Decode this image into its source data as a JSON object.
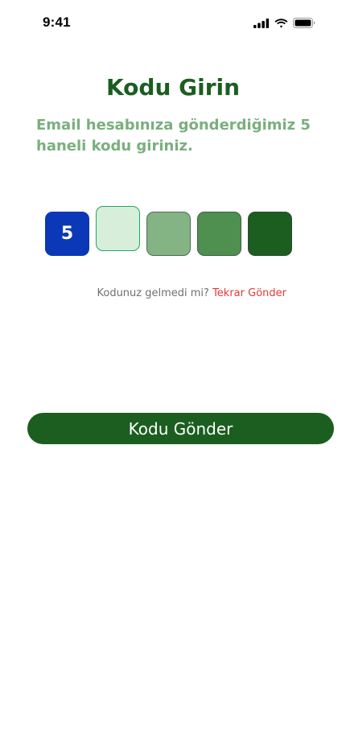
{
  "status_bar": {
    "time": "9:41",
    "icons": [
      "signal-icon",
      "wifi-icon",
      "battery-icon"
    ]
  },
  "title": "Kodu Girin",
  "subtitle": "Email hesabınıza gönderdiğimiz 5 haneli kodu giriniz.",
  "code_inputs": [
    "5",
    "",
    "",
    "",
    ""
  ],
  "resend": {
    "prompt": "Kodunuz gelmedi mi?",
    "link": "Tekrar Gönder"
  },
  "submit_label": "Kodu Gönder",
  "colors": {
    "primary": "#1b5e20",
    "subtitle": "#7aaf7d",
    "filled_box": "#0b38b6",
    "active_box": "#d7eedb",
    "link": "#e53935"
  }
}
